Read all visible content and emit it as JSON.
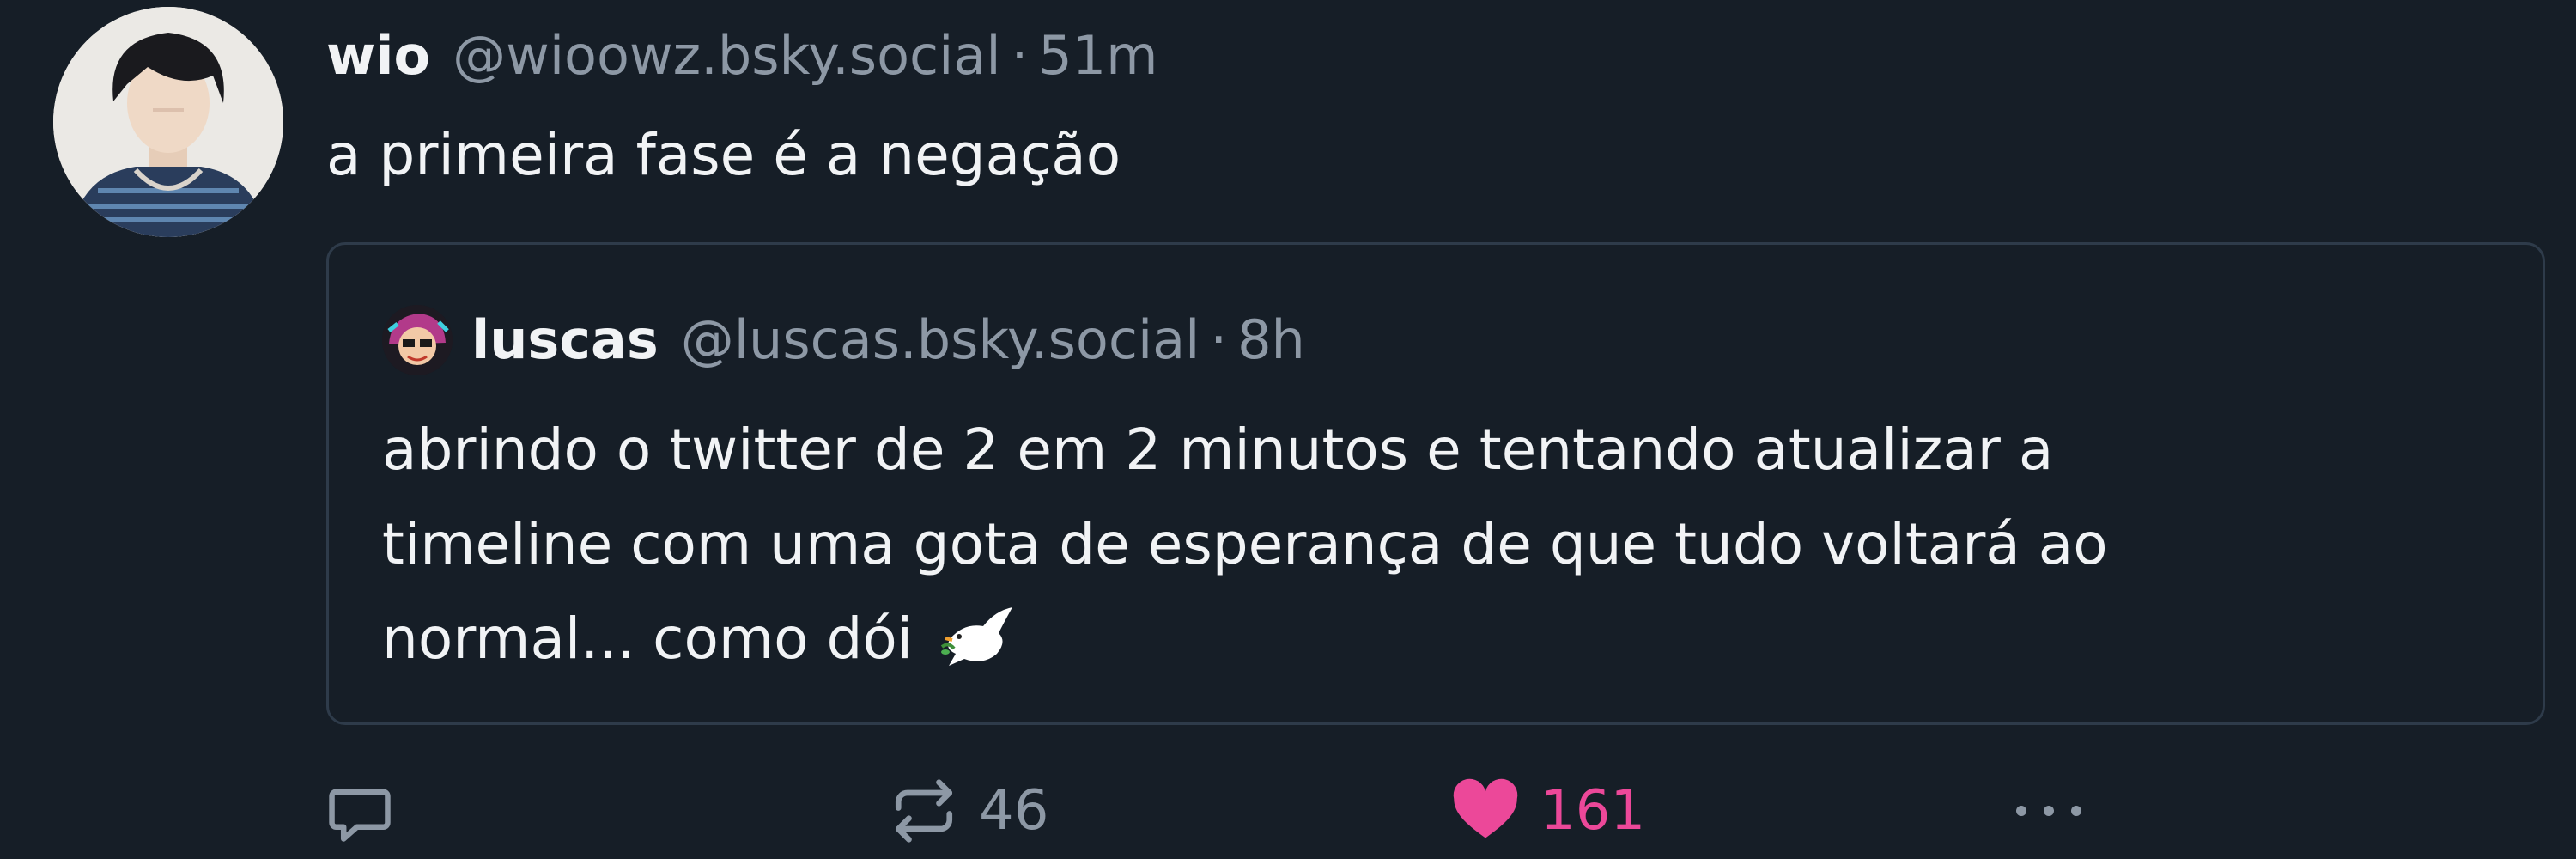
{
  "post": {
    "author": {
      "name": "wio",
      "handle": "@wioowz.bsky.social",
      "avatar_icon": "avatar-photo-icon"
    },
    "separator": "·",
    "time": "51m",
    "text": "a primeira fase é a negação",
    "quote": {
      "author": {
        "name": "luscas",
        "handle": "@luscas.bsky.social",
        "avatar_icon": "avatar-cartoon-icon"
      },
      "separator": "·",
      "time": "8h",
      "lines": [
        "abrindo o twitter de 2 em 2 minutos e tentando atualizar a",
        "timeline com uma gota de esperança de que tudo voltará ao",
        "normal... como dói"
      ],
      "emoji": "dove-icon"
    },
    "actions": {
      "reply_icon": "reply-icon",
      "repost_icon": "repost-icon",
      "repost_count": "46",
      "like_icon": "heart-icon",
      "like_count": "161",
      "more_icon": "more-icon"
    },
    "colors": {
      "background": "#161e27",
      "muted_text": "#8d98a5",
      "like_accent": "#ec4899",
      "quote_border": "#2e3b4a"
    }
  }
}
